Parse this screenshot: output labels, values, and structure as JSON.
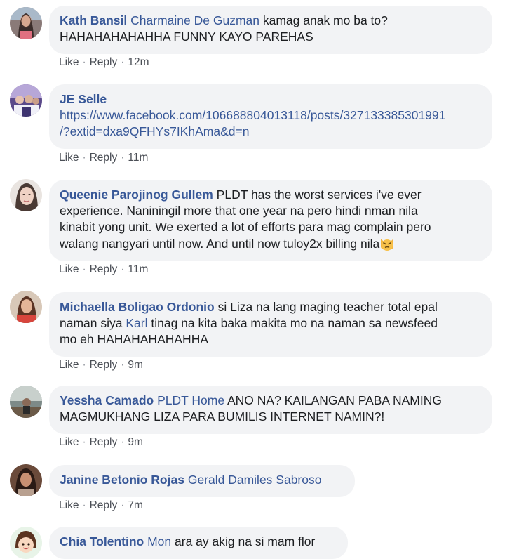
{
  "comments": [
    {
      "author": "Kath Bansil",
      "mention": "Charmaine De Guzman",
      "text_line1": "kamag anak mo ba to?",
      "text_line2": "HAHAHAHAHAHHA FUNNY KAYO PAREHAS",
      "like": "Like",
      "reply": "Reply",
      "sep": "·",
      "time": "12m",
      "avatar_icon": "avatar-photo-girl-long-hair"
    },
    {
      "author": "JE Selle",
      "link_line1": "https://www.facebook.com/106688804013118/posts/327133385301991",
      "link_line2": "/?extid=dxa9QFHYs7IKhAma&d=n",
      "like": "Like",
      "reply": "Reply",
      "sep": "·",
      "time": "11m",
      "avatar_icon": "avatar-photo-group"
    },
    {
      "author": "Queenie Parojinog Gullem",
      "text_line1": "PLDT has the worst services i've ever",
      "text_line2": "experience. Naniningil more that one year na pero hindi nman nila",
      "text_line3": "kinabit yong unit. We exerted a lot of efforts para mag complain pero",
      "text_line4": "walang nangyari until now. And until now tuloy2x billing nila",
      "emoji": "pouting-cat-emoji",
      "like": "Like",
      "reply": "Reply",
      "sep": "·",
      "time": "11m",
      "avatar_icon": "avatar-photo-woman-face"
    },
    {
      "author": "Michaella Boligao Ordonio",
      "text_line1a": "si Liza na lang maging teacher total epal",
      "text_line2a": "naman siya",
      "mention": "Karl",
      "text_line2b": "tinag na kita baka makita mo na naman sa newsfeed",
      "text_line3": "mo eh HAHAHAHAHAHHA",
      "like": "Like",
      "reply": "Reply",
      "sep": "·",
      "time": "9m",
      "avatar_icon": "avatar-photo-woman-red"
    },
    {
      "author": "Yessha Camado",
      "mention": "PLDT Home",
      "text_line1": "ANO NA? KAILANGAN PABA NAMING",
      "text_line2": "MAGMUKHANG LIZA PARA BUMILIS INTERNET NAMIN?!",
      "like": "Like",
      "reply": "Reply",
      "sep": "·",
      "time": "9m",
      "avatar_icon": "avatar-photo-outdoor"
    },
    {
      "author": "Janine Betonio Rojas",
      "mention": "Gerald Damiles Sabroso",
      "like": "Like",
      "reply": "Reply",
      "sep": "·",
      "time": "7m",
      "avatar_icon": "avatar-photo-woman-dark"
    },
    {
      "author": "Chia Tolentino",
      "mention": "Mon",
      "text_line1": "ara ay akig na si mam flor",
      "avatar_icon": "avatar-cartoon-girl"
    }
  ]
}
